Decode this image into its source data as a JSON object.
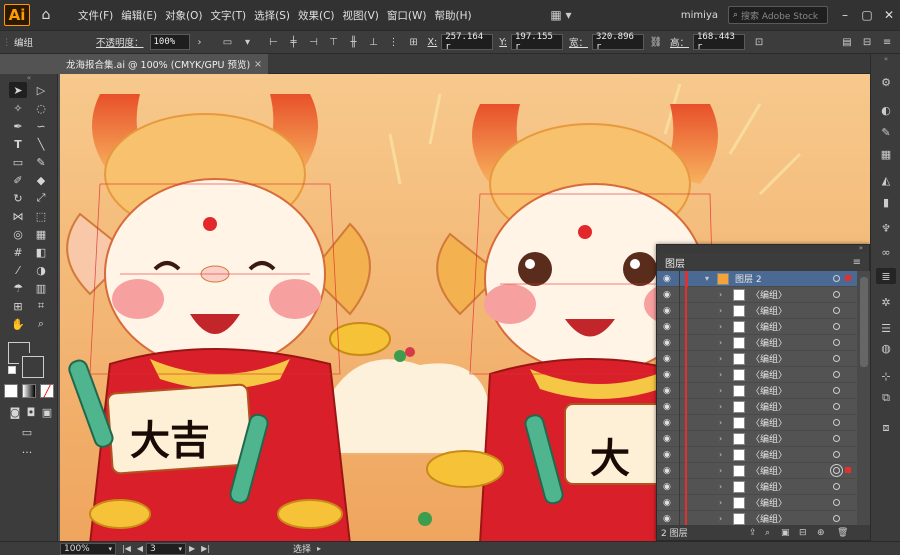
{
  "menubar": {
    "logo": "Ai",
    "items": [
      "文件(F)",
      "编辑(E)",
      "对象(O)",
      "文字(T)",
      "选择(S)",
      "效果(C)",
      "视图(V)",
      "窗口(W)",
      "帮助(H)"
    ],
    "user": "mimiya",
    "stock_placeholder": "搜索 Adobe Stock"
  },
  "controlbar": {
    "selection": "编组",
    "opacity_label": "不透明度：",
    "opacity_value": "100%",
    "x_label": "X:",
    "x_value": "257.164 r",
    "y_label": "Y:",
    "y_value": "197.155 r",
    "w_label": "宽：",
    "w_value": "320.896 r",
    "h_label": "高：",
    "h_value": "168.443 r"
  },
  "document": {
    "tab_title": "龙海报合集.ai @ 100% (CMYK/GPU 预览)",
    "close": "×"
  },
  "artwork": {
    "left_banner_text": "大吉",
    "right_banner_text": "大"
  },
  "layers_panel": {
    "title": "图层",
    "layer_name": "图层 2",
    "rows": [
      "〈编组〉",
      "〈编组〉",
      "〈编组〉",
      "〈编组〉",
      "〈编组〉",
      "〈编组〉",
      "〈编组〉",
      "〈编组〉",
      "〈编组〉",
      "〈编组〉",
      "〈编组〉",
      "〈编组〉",
      "〈编组〉",
      "〈编组〉",
      "〈编组〉"
    ],
    "selected_row_index": 11,
    "footer_count": "2 图层"
  },
  "statusbar": {
    "zoom": "100%",
    "page": "3",
    "tool_status": "选择"
  },
  "colors": {
    "accent": "#4b6a93",
    "layer_color": "#e03030",
    "background": "#f3b571"
  }
}
